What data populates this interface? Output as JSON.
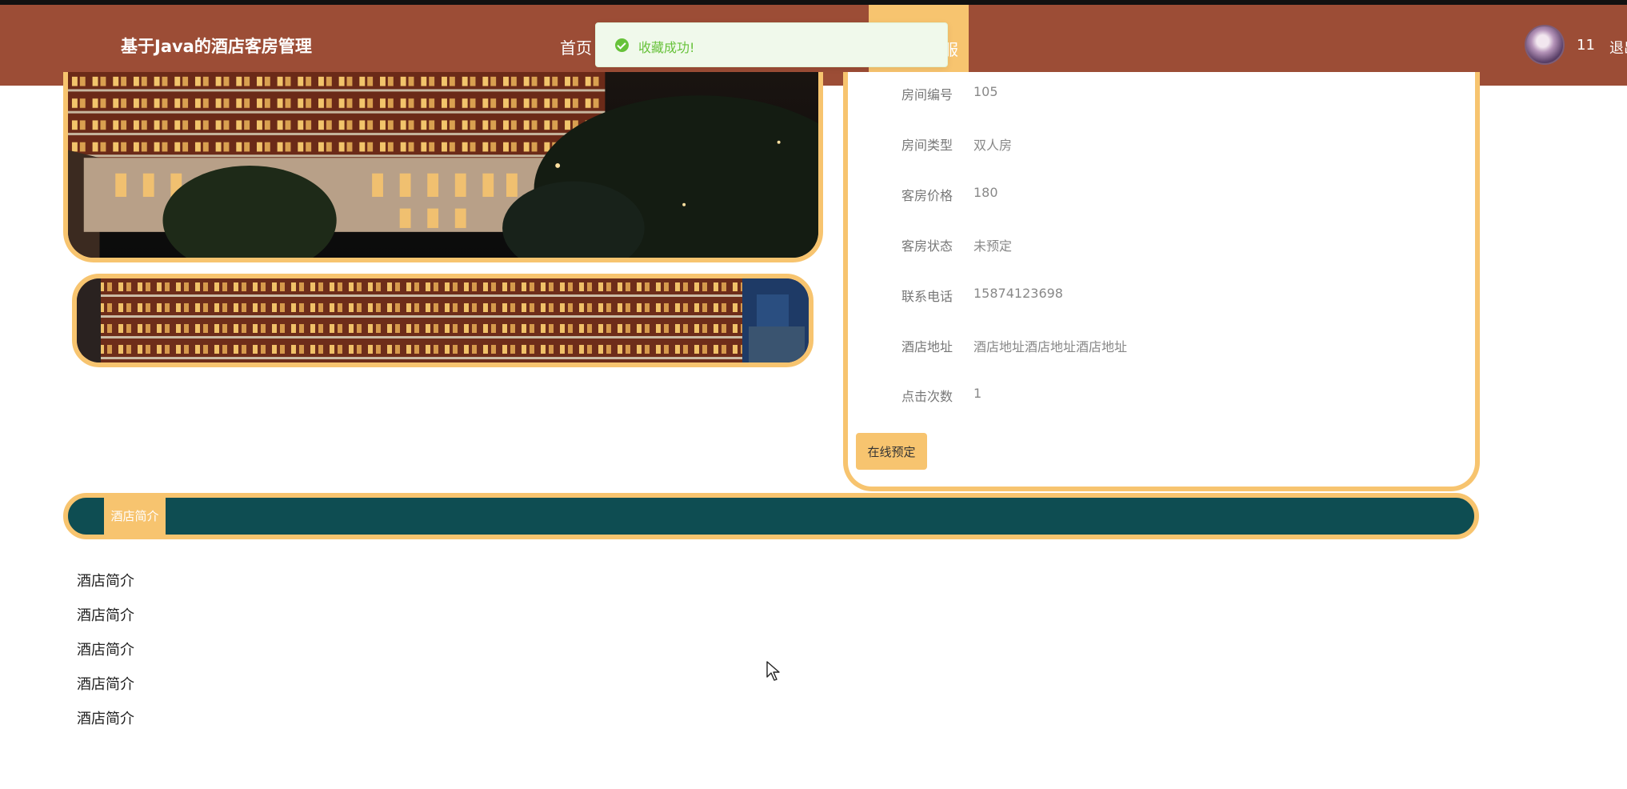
{
  "header": {
    "site_title": "基于Java的酒店客房管理",
    "nav_home": "首页",
    "nav_active_label": "服",
    "username": "11",
    "logout": "退出"
  },
  "toast": {
    "message": "收藏成功!",
    "color": "#67c23a"
  },
  "room_info": {
    "fields": [
      {
        "label": "房间编号",
        "value": "105"
      },
      {
        "label": "房间类型",
        "value": "双人房"
      },
      {
        "label": "客房价格",
        "value": "180"
      },
      {
        "label": "客房状态",
        "value": "未预定"
      },
      {
        "label": "联系电话",
        "value": "15874123698"
      },
      {
        "label": "酒店地址",
        "value": "酒店地址酒店地址酒店地址"
      },
      {
        "label": "点击次数",
        "value": "1"
      }
    ],
    "book_button": "在线预定"
  },
  "intro": {
    "tab_label": "酒店简介",
    "lines": [
      "酒店简介",
      "酒店简介",
      "酒店简介",
      "酒店简介",
      "酒店简介"
    ]
  },
  "colors": {
    "header_bg": "#9c4d36",
    "accent": "#f7c46f",
    "intro_bar": "#0e4d52"
  },
  "icons": {
    "toast": "check-circle-icon",
    "cursor": "mouse-pointer-icon"
  }
}
